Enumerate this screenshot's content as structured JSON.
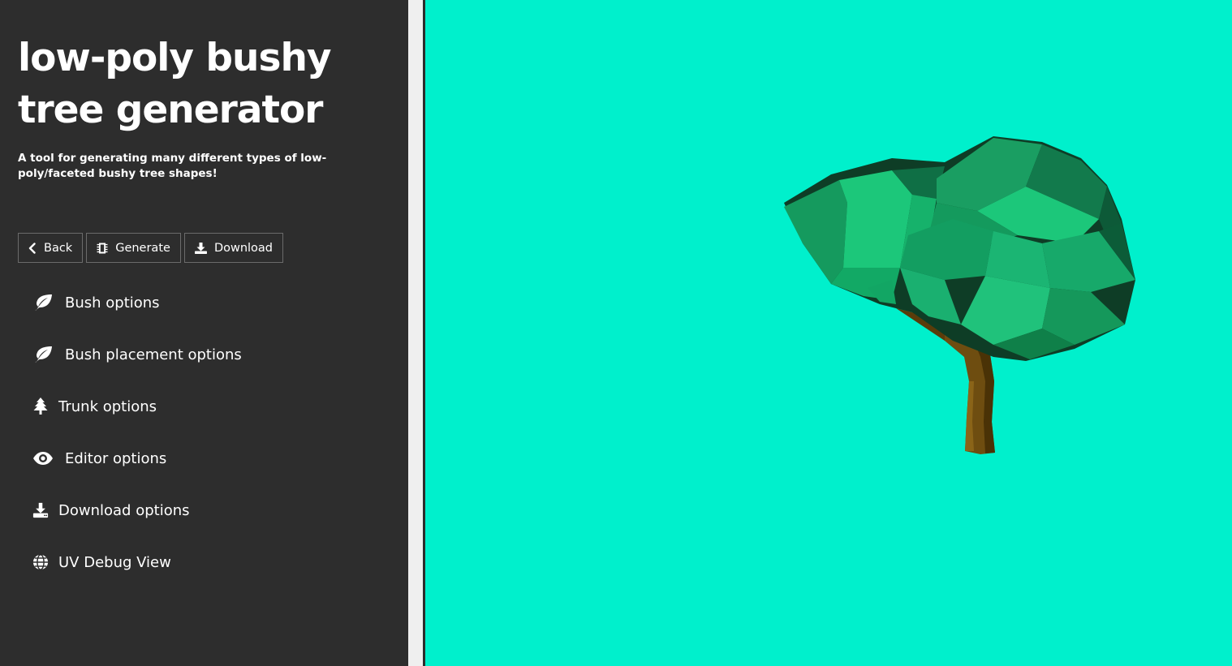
{
  "sidebar": {
    "title": "low-poly bushy tree generator",
    "subtitle": "A tool for generating many different types of low-poly/faceted bushy tree shapes!",
    "toolbar": {
      "back_label": "Back",
      "generate_label": "Generate",
      "download_label": "Download"
    },
    "menu": [
      {
        "label": "Bush options",
        "icon": "leaf-icon"
      },
      {
        "label": "Bush placement options",
        "icon": "leaf-icon"
      },
      {
        "label": "Trunk options",
        "icon": "tree-icon"
      },
      {
        "label": "Editor options",
        "icon": "eye-icon"
      },
      {
        "label": "Download options",
        "icon": "download-icon"
      },
      {
        "label": "UV Debug View",
        "icon": "globe-icon"
      }
    ]
  },
  "viewport": {
    "background_color": "#00f0cc",
    "tree_foliage_color": "#1fc07a",
    "tree_trunk_color": "#6b4a12"
  },
  "colors": {
    "sidebar_bg": "#2d2d2d",
    "text": "#ffffff"
  }
}
